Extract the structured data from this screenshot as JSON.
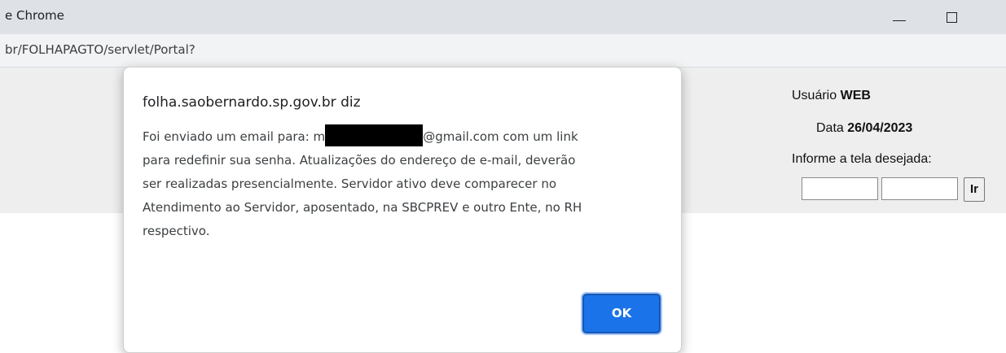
{
  "window": {
    "title": "e Chrome",
    "minimize_icon": "minimize-icon",
    "maximize_icon": "maximize-icon"
  },
  "address_bar": {
    "url": "br/FOLHAPAGTO/servlet/Portal?"
  },
  "page": {
    "user_label": "Usuário",
    "user_value": "WEB",
    "date_label": "Data",
    "date_value": "26/04/2023",
    "prompt": "Informe a tela desejada:",
    "input_1_value": "",
    "input_2_value": "",
    "go_button": "Ir"
  },
  "dialog": {
    "title": "folha.saobernardo.sp.gov.br diz",
    "line1_prefix": "Foi enviado um email para: m",
    "line1_suffix": "@gmail.com com um link",
    "line2": "para redefinir sua senha. Atualizações do endereço de e-mail, deverão",
    "line3": "ser realizadas presencialmente. Servidor ativo deve comparecer no",
    "line4": "Atendimento ao Servidor, aposentado, na SBCPREV e outro Ente, no RH",
    "line5": "respectivo.",
    "ok_button": "OK",
    "accent_color": "#1a73e8"
  }
}
